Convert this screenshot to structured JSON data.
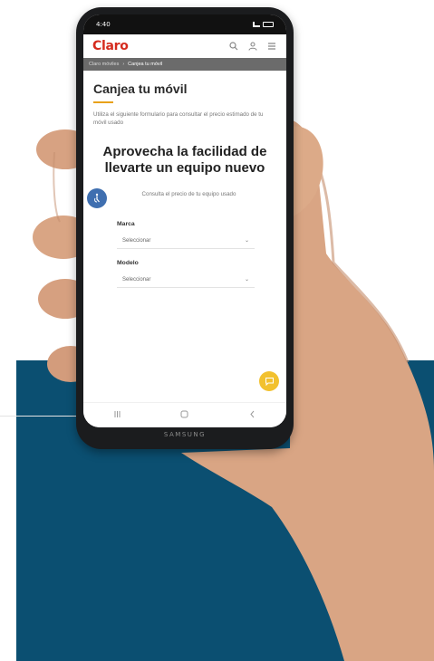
{
  "status": {
    "time": "4:40"
  },
  "header": {
    "logo": "Claro",
    "icons": [
      "search-icon",
      "user-icon",
      "menu-icon"
    ]
  },
  "breadcrumb": {
    "parent": "Claro móviles",
    "current": "Canjea tu móvil"
  },
  "page": {
    "title": "Canjea tu móvil",
    "intro": "Utiliza el siguiente formulario para consultar el precio estimado de tu móvil usado"
  },
  "card": {
    "title": "Aprovecha la facilidad de llevarte un equipo nuevo",
    "consult": "Consulta el precio de tu equipo usado"
  },
  "form": {
    "brand_label": "Marca",
    "brand_value": "Seleccionar",
    "model_label": "Modelo",
    "model_value": "Seleccionar"
  },
  "navbar": {
    "icons": [
      "recent-apps-icon",
      "home-icon",
      "back-icon"
    ]
  },
  "device": {
    "brand": "SAMSUNG"
  },
  "colors": {
    "brand_red": "#d52b1e",
    "accent_yellow": "#f2c12e",
    "panel_blue": "#0b4f71",
    "access_blue": "#3f6fb0"
  }
}
